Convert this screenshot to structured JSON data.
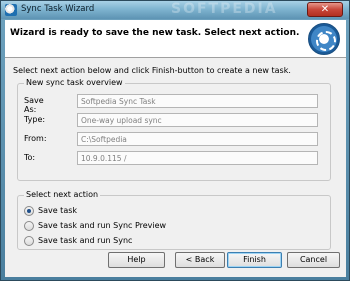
{
  "window": {
    "title": "Sync Task Wizard",
    "close_glyph": "✕",
    "watermark": "SOFTPEDIA"
  },
  "header": {
    "heading": "Wizard is ready to save the new task. Select next action."
  },
  "instruction": "Select next action below and click Finish-button to create a new task.",
  "overview": {
    "legend": "New sync task overview",
    "fields": [
      {
        "label": "Save As:",
        "value": "Softpedia Sync Task"
      },
      {
        "label": "Type:",
        "value": "One-way upload sync"
      },
      {
        "label": "From:",
        "value": "C:\\Softpedia"
      },
      {
        "label": "To:",
        "value": "10.9.0.115 /"
      }
    ]
  },
  "next_action": {
    "legend": "Select next action",
    "options": [
      {
        "label": "Save task",
        "selected": true
      },
      {
        "label": "Save task and run Sync Preview",
        "selected": false
      },
      {
        "label": "Save task and run Sync",
        "selected": false
      }
    ]
  },
  "buttons": {
    "help": "Help",
    "back": "< Back",
    "finish": "Finish",
    "cancel": "Cancel"
  }
}
